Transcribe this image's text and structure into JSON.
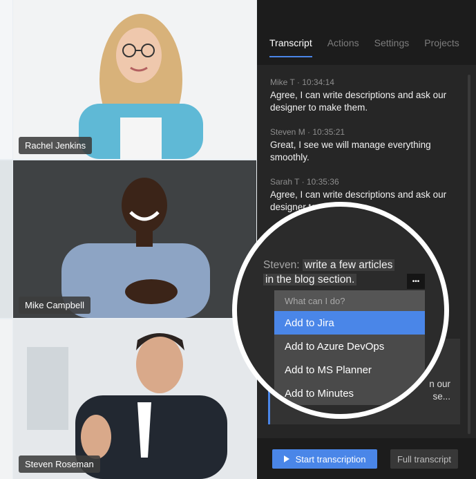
{
  "participants": [
    {
      "name": "Rachel Jenkins"
    },
    {
      "name": "Mike Campbell"
    },
    {
      "name": "Steven Roseman"
    }
  ],
  "tabs": [
    "Transcript",
    "Actions",
    "Settings",
    "Projects"
  ],
  "transcript": [
    {
      "meta": "Mike T · 10:34:14",
      "text": "Agree, I can write descriptions and ask our designer to make them."
    },
    {
      "meta": "Steven M · 10:35:21",
      "text": "Great, I see we will manage everything smoothly."
    },
    {
      "meta": "Sarah T · 10:35:36",
      "text": "Agree, I can write descriptions and ask our designer to make them."
    }
  ],
  "partial_card": {
    "line1": "n our",
    "line2": "se..."
  },
  "magnifier": {
    "speaker": "Steven:",
    "selected_line1": "write a few articles",
    "selected_line2": "in the blog section.",
    "more_label": "•••",
    "menu_header": "What can I do?",
    "menu_items": [
      "Add to Jira",
      "Add to Azure DevOps",
      "Add to MS Planner",
      "Add to Minutes"
    ]
  },
  "footer": {
    "start_label": "Start transcription",
    "full_label": "Full transcript"
  },
  "colors": {
    "accent": "#4a86e8",
    "panel": "#1c1c1c",
    "transcript_bg": "#262626"
  },
  "icons": {
    "start": "play-icon",
    "more": "more-icon"
  }
}
